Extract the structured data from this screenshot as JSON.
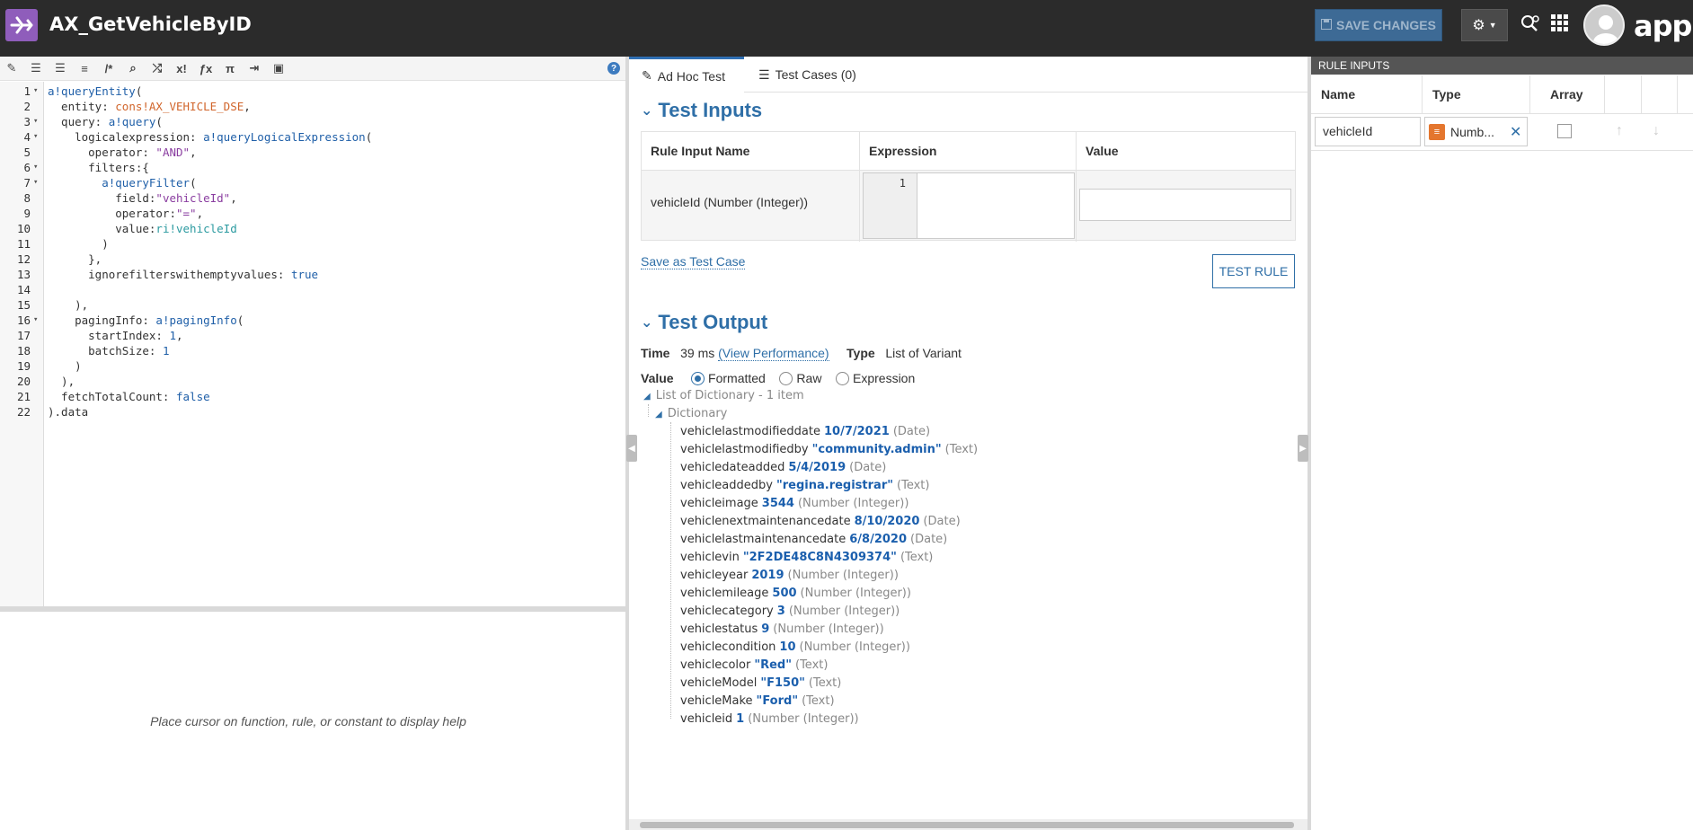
{
  "header": {
    "title": "AX_GetVehicleByID",
    "save_label": "SAVE CHANGES",
    "brand": "appiai"
  },
  "editor": {
    "lines": [
      {
        "n": "1",
        "fold": "▾",
        "html": "<span class=\"k-fn\">a!queryEntity</span>("
      },
      {
        "n": "2",
        "fold": "",
        "html": "  entity: <span class=\"k-const\">cons!AX_VEHICLE_DSE</span>,"
      },
      {
        "n": "3",
        "fold": "▾",
        "html": "  query: <span class=\"k-fn\">a!query</span>("
      },
      {
        "n": "4",
        "fold": "▾",
        "html": "    logicalexpression: <span class=\"k-fn\">a!queryLogicalExpression</span>("
      },
      {
        "n": "5",
        "fold": "",
        "html": "      operator: <span class=\"k-str\">\"AND\"</span>,"
      },
      {
        "n": "6",
        "fold": "▾",
        "html": "      filters:{"
      },
      {
        "n": "7",
        "fold": "▾",
        "html": "        <span class=\"k-fn\">a!queryFilter</span>("
      },
      {
        "n": "8",
        "fold": "",
        "html": "          field:<span class=\"k-str\">\"vehicleId\"</span>,"
      },
      {
        "n": "9",
        "fold": "",
        "html": "          operator:<span class=\"k-str\">\"=\"</span>,"
      },
      {
        "n": "10",
        "fold": "",
        "html": "          value:<span class=\"k-ri\">ri!vehicleId</span>"
      },
      {
        "n": "11",
        "fold": "",
        "html": "        )"
      },
      {
        "n": "12",
        "fold": "",
        "html": "      },"
      },
      {
        "n": "13",
        "fold": "",
        "html": "      ignorefilterswithemptyvalues: <span class=\"k-num\">true</span>"
      },
      {
        "n": "14",
        "fold": "",
        "html": ""
      },
      {
        "n": "15",
        "fold": "",
        "html": "    ),"
      },
      {
        "n": "16",
        "fold": "▾",
        "html": "    pagingInfo: <span class=\"k-fn\">a!pagingInfo</span>("
      },
      {
        "n": "17",
        "fold": "",
        "html": "      startIndex: <span class=\"k-num\">1</span>,"
      },
      {
        "n": "18",
        "fold": "",
        "html": "      batchSize: <span class=\"k-num\">1</span>"
      },
      {
        "n": "19",
        "fold": "",
        "html": "    )"
      },
      {
        "n": "20",
        "fold": "",
        "html": "  ),"
      },
      {
        "n": "21",
        "fold": "",
        "html": "  fetchTotalCount: <span class=\"k-num\">false</span>"
      },
      {
        "n": "22",
        "fold": "",
        "html": ").data"
      }
    ],
    "help_text": "Place cursor on function, rule, or constant to display help"
  },
  "tabs": {
    "adhoc": "Ad Hoc Test",
    "cases": "Test Cases (0)"
  },
  "test_inputs": {
    "title": "Test Inputs",
    "col_name": "Rule Input Name",
    "col_expr": "Expression",
    "col_value": "Value",
    "row_name": "vehicleId (Number (Integer))",
    "expr_line": "1",
    "save_link": "Save as Test Case",
    "test_button": "TEST RULE"
  },
  "test_output": {
    "title": "Test Output",
    "time_label": "Time",
    "time_value": "39 ms",
    "perf_link": "(View Performance)",
    "type_label": "Type",
    "type_value": "List of Variant",
    "value_label": "Value",
    "opt_formatted": "Formatted",
    "opt_raw": "Raw",
    "opt_expression": "Expression",
    "list_label": "List of Dictionary - 1 item",
    "dict_label": "Dictionary",
    "items": [
      {
        "name": "vehiclelastmodifieddate",
        "value": "10/7/2021",
        "type": "(Date)"
      },
      {
        "name": "vehiclelastmodifiedby",
        "value": "\"community.admin\"",
        "type": "(Text)"
      },
      {
        "name": "vehicledateadded",
        "value": "5/4/2019",
        "type": "(Date)"
      },
      {
        "name": "vehicleaddedby",
        "value": "\"regina.registrar\"",
        "type": "(Text)"
      },
      {
        "name": "vehicleimage",
        "value": "3544",
        "type": "(Number (Integer))"
      },
      {
        "name": "vehiclenextmaintenancedate",
        "value": "8/10/2020",
        "type": "(Date)"
      },
      {
        "name": "vehiclelastmaintenancedate",
        "value": "6/8/2020",
        "type": "(Date)"
      },
      {
        "name": "vehiclevin",
        "value": "\"2F2DE48C8N4309374\"",
        "type": "(Text)"
      },
      {
        "name": "vehicleyear",
        "value": "2019",
        "type": "(Number (Integer))"
      },
      {
        "name": "vehiclemileage",
        "value": "500",
        "type": "(Number (Integer))"
      },
      {
        "name": "vehiclecategory",
        "value": "3",
        "type": "(Number (Integer))"
      },
      {
        "name": "vehiclestatus",
        "value": "9",
        "type": "(Number (Integer))"
      },
      {
        "name": "vehiclecondition",
        "value": "10",
        "type": "(Number (Integer))"
      },
      {
        "name": "vehiclecolor",
        "value": "\"Red\"",
        "type": "(Text)"
      },
      {
        "name": "vehicleModel",
        "value": "\"F150\"",
        "type": "(Text)"
      },
      {
        "name": "vehicleMake",
        "value": "\"Ford\"",
        "type": "(Text)"
      },
      {
        "name": "vehicleid",
        "value": "1",
        "type": "(Number (Integer))"
      }
    ]
  },
  "rule_inputs": {
    "title": "RULE INPUTS",
    "col_name": "Name",
    "col_type": "Type",
    "col_array": "Array",
    "name_value": "vehicleId",
    "type_value": "Numb..."
  }
}
